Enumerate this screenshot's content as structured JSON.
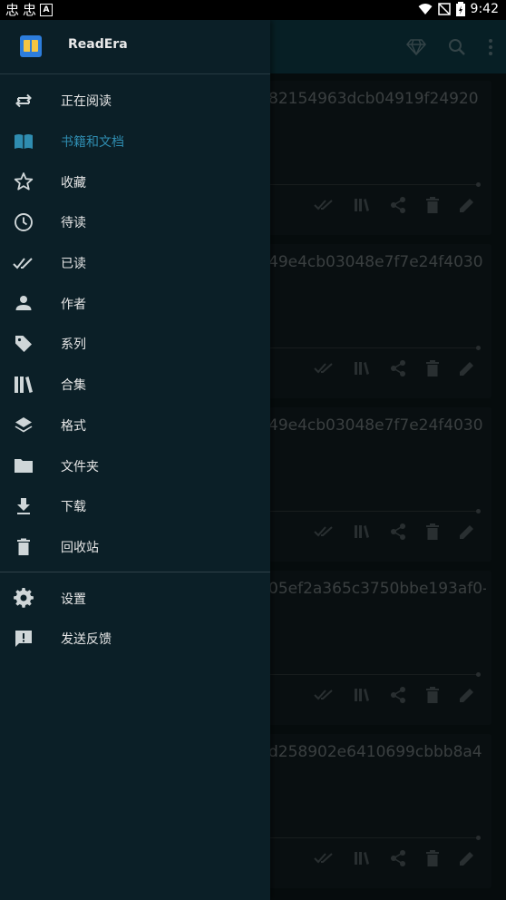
{
  "status_bar": {
    "time": "9:42",
    "notification_glyph": "忠"
  },
  "app": {
    "name": "ReadEra"
  },
  "drawer": {
    "primary": [
      {
        "label": "正在阅读",
        "icon": "repeat-icon",
        "active": false
      },
      {
        "label": "书籍和文档",
        "icon": "book-icon",
        "active": true
      },
      {
        "label": "收藏",
        "icon": "star-icon",
        "active": false
      },
      {
        "label": "待读",
        "icon": "clock-icon",
        "active": false
      },
      {
        "label": "已读",
        "icon": "double-check-icon",
        "active": false
      },
      {
        "label": "作者",
        "icon": "person-icon",
        "active": false
      },
      {
        "label": "系列",
        "icon": "tag-icon",
        "active": false
      },
      {
        "label": "合集",
        "icon": "library-icon",
        "active": false
      },
      {
        "label": "格式",
        "icon": "layers-icon",
        "active": false
      },
      {
        "label": "文件夹",
        "icon": "folder-icon",
        "active": false
      },
      {
        "label": "下载",
        "icon": "download-icon",
        "active": false
      },
      {
        "label": "回收站",
        "icon": "trash-icon",
        "active": false
      }
    ],
    "secondary": [
      {
        "label": "设置",
        "icon": "gear-icon"
      },
      {
        "label": "发送反馈",
        "icon": "feedback-icon"
      }
    ]
  },
  "background_cards": [
    {
      "title": "82154963dcb04919f24920"
    },
    {
      "title": "49e4cb03048e7f7e24f4030"
    },
    {
      "title": "49e4cb03048e7f7e24f4030"
    },
    {
      "title": "05ef2a365c3750bbe193af0-"
    },
    {
      "title": "d258902e6410699cbbb8a4"
    }
  ],
  "colors": {
    "drawer_bg": "#0b1f27",
    "appbar_bg": "#0d3a44",
    "active": "#2f8db1"
  }
}
